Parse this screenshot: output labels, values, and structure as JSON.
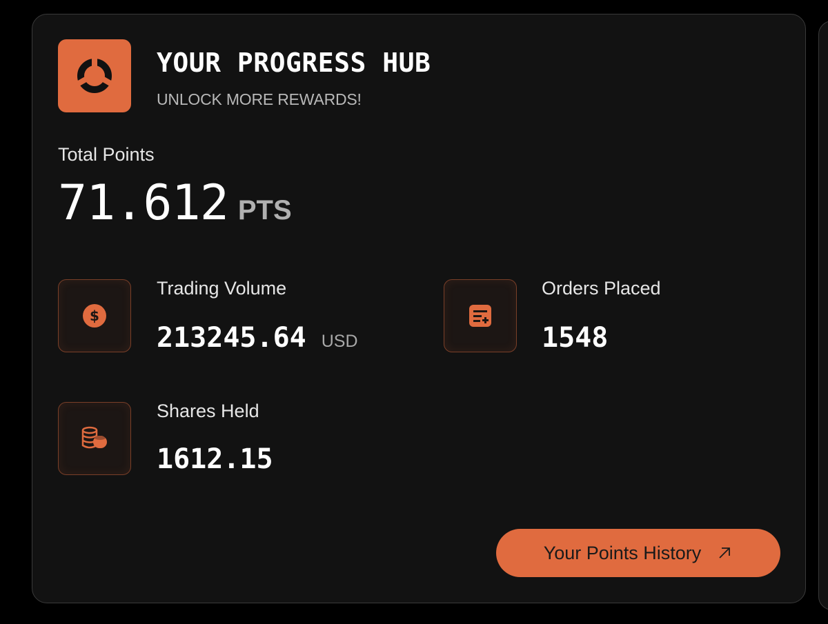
{
  "header": {
    "title": "YOUR PROGRESS HUB",
    "subtitle": "UNLOCK MORE REWARDS!",
    "logo_icon": "segmented-ring-icon"
  },
  "total_points": {
    "label": "Total Points",
    "value": "71.612",
    "unit": "PTS"
  },
  "stats": {
    "trading_volume": {
      "label": "Trading Volume",
      "value": "213245.64",
      "unit": "USD",
      "icon": "dollar-coin-icon"
    },
    "orders_placed": {
      "label": "Orders Placed",
      "value": "1548",
      "icon": "order-list-add-icon"
    },
    "shares_held": {
      "label": "Shares Held",
      "value": "1612.15",
      "icon": "coin-stack-icon"
    }
  },
  "history_button": {
    "label": "Your Points History",
    "icon": "arrow-up-right-icon"
  },
  "colors": {
    "accent": "#e06b3f",
    "card_background": "#121212",
    "page_background": "#000000"
  }
}
